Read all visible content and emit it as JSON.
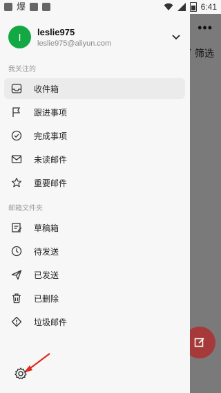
{
  "status_bar": {
    "left_glyph": "爆",
    "time": "6:41"
  },
  "behind": {
    "more": "•••",
    "filter_label": "了 筛选"
  },
  "account": {
    "avatar_letter": "l",
    "name": "leslie975",
    "email": "leslie975@aliyun.com"
  },
  "sections": {
    "favorites": "我关注的",
    "folders": "邮箱文件夹"
  },
  "favorites": [
    {
      "label": "收件箱",
      "icon": "inbox-icon"
    },
    {
      "label": "跟进事项",
      "icon": "flag-icon"
    },
    {
      "label": "完成事项",
      "icon": "check-circle-icon"
    },
    {
      "label": "未读邮件",
      "icon": "envelope-icon"
    },
    {
      "label": "重要邮件",
      "icon": "star-icon"
    }
  ],
  "folders": [
    {
      "label": "草稿箱",
      "icon": "draft-icon"
    },
    {
      "label": "待发送",
      "icon": "clock-icon"
    },
    {
      "label": "已发送",
      "icon": "send-icon"
    },
    {
      "label": "已删除",
      "icon": "trash-icon"
    },
    {
      "label": "垃圾邮件",
      "icon": "spam-icon"
    }
  ],
  "colors": {
    "avatar": "#12a844",
    "fab": "#a63a3a",
    "annotation_arrow": "#e0281e"
  }
}
